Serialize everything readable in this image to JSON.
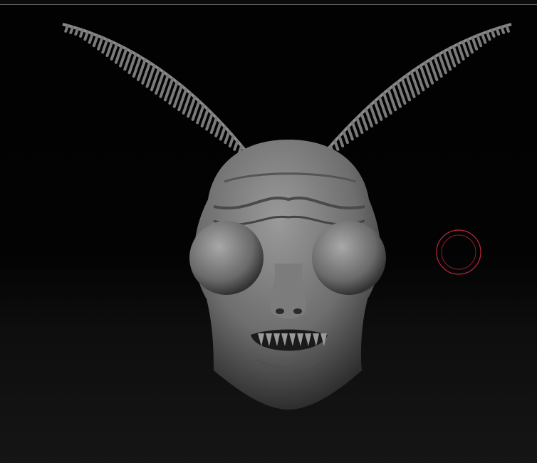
{
  "canvas": {
    "background_top": "#020202",
    "background_bottom": "#151515",
    "frame_line_color": "#6a6a6a"
  },
  "model": {
    "name_icon": "alien-head-sculpt",
    "material_color": "#8a8a8a"
  },
  "brush_cursor": {
    "icon": "brush-cursor-icon",
    "color": "#c0283a"
  }
}
